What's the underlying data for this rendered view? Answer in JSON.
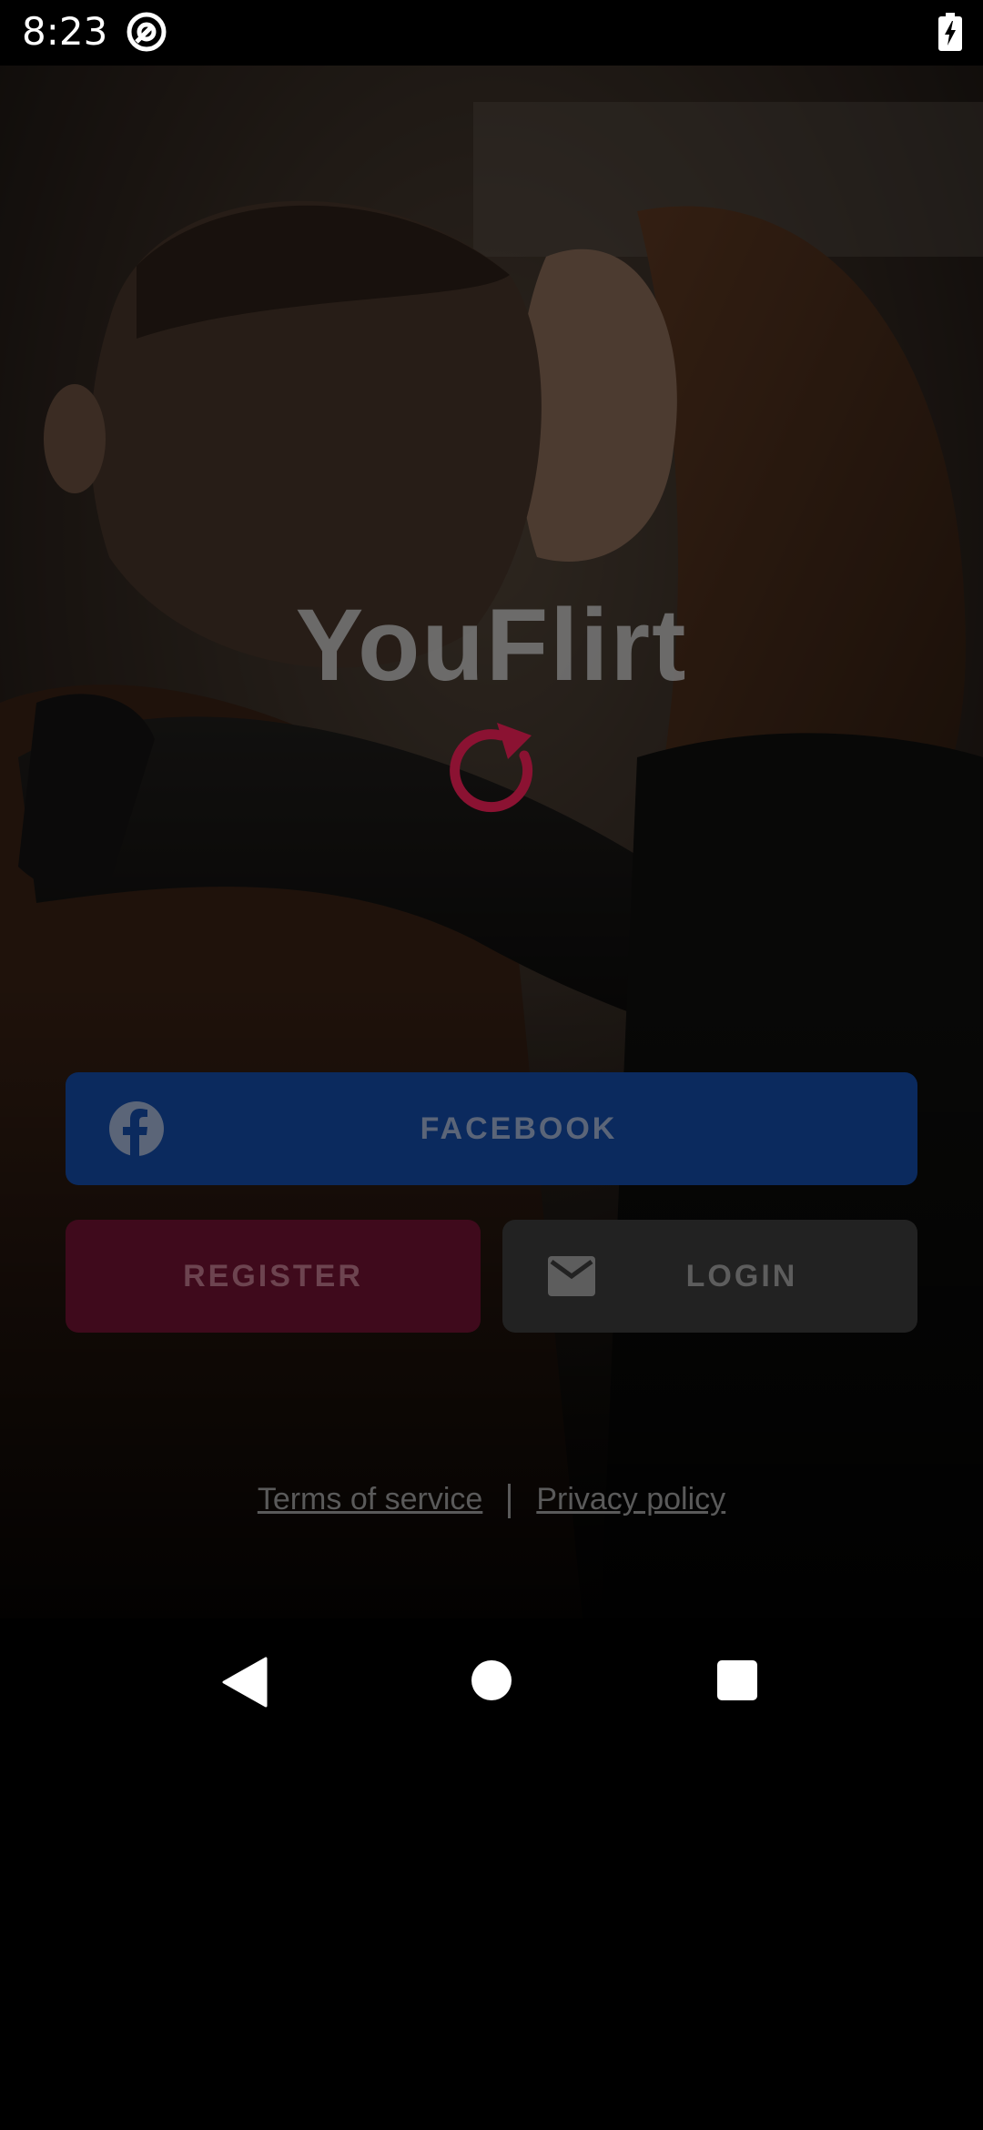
{
  "status_bar": {
    "time": "8:23",
    "app_icon": "at-sign-circle-icon",
    "battery_icon": "battery-charging-icon"
  },
  "app": {
    "title": "YouFlirt",
    "spinner_icon": "refresh-spinner-icon",
    "spinner_color": "#8b1232",
    "buttons": {
      "facebook_label": "FACEBOOK",
      "facebook_icon": "facebook-icon",
      "facebook_color": "#0b2a5e",
      "register_label": "REGISTER",
      "register_color": "#3f0a1c",
      "login_label": "LOGIN",
      "login_icon": "mail-icon",
      "login_color": "#222222"
    },
    "legal": {
      "terms_label": "Terms of service",
      "privacy_label": "Privacy policy"
    }
  },
  "nav_bar": {
    "back_icon": "back-triangle-icon",
    "home_icon": "home-circle-icon",
    "recents_icon": "recents-square-icon"
  }
}
